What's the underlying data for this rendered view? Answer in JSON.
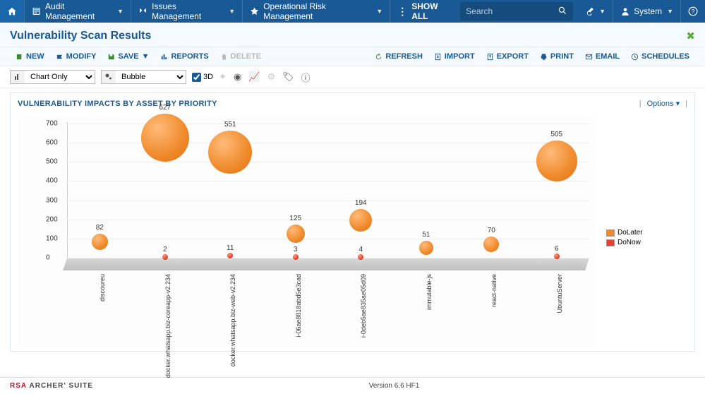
{
  "nav": {
    "items": [
      "Audit Management",
      "Issues Management",
      "Operational Risk Management"
    ],
    "show_all": "SHOW ALL",
    "search_placeholder": "Search",
    "user_label": "System"
  },
  "page": {
    "title": "Vulnerability Scan Results"
  },
  "toolbar": {
    "new": "NEW",
    "modify": "MODIFY",
    "save": "SAVE",
    "reports": "REPORTS",
    "delete": "DELETE",
    "refresh": "REFRESH",
    "import": "IMPORT",
    "export": "EXPORT",
    "print": "PRINT",
    "email": "EMAIL",
    "schedules": "SCHEDULES"
  },
  "toolbar2": {
    "view_mode": "Chart Only",
    "chart_type": "Bubble",
    "threeD_label": "3D"
  },
  "chart": {
    "title": "VULNERABILITY IMPACTS BY ASSET BY PRIORITY",
    "options_label": "Options",
    "legend": [
      {
        "name": "DoLater",
        "color": "#f08a2c"
      },
      {
        "name": "DoNow",
        "color": "#e8442c"
      }
    ]
  },
  "chart_data": {
    "type": "bubble",
    "ylim": [
      0,
      700
    ],
    "yticks": [
      0,
      100,
      200,
      300,
      400,
      500,
      600,
      700
    ],
    "categories": [
      "discoureu",
      "docker.whatsapp.biz-coreapp-v2.234",
      "docker.whatsapp.biz-web-v2.234",
      "i-06ae8818abd5e3cad",
      "i-0deb5ae835ae05d09",
      "immutable-js",
      "react-native",
      "UbuntuServer"
    ],
    "series": [
      {
        "name": "DoLater",
        "values": [
          82,
          627,
          551,
          125,
          194,
          51,
          70,
          505
        ]
      },
      {
        "name": "DoNow",
        "values": [
          null,
          2,
          11,
          3,
          4,
          null,
          null,
          6
        ]
      }
    ]
  },
  "footer": {
    "brand_a": "RSA",
    "brand_b": "ARCHER' SUITE",
    "version": "Version 6.6 HF1"
  }
}
